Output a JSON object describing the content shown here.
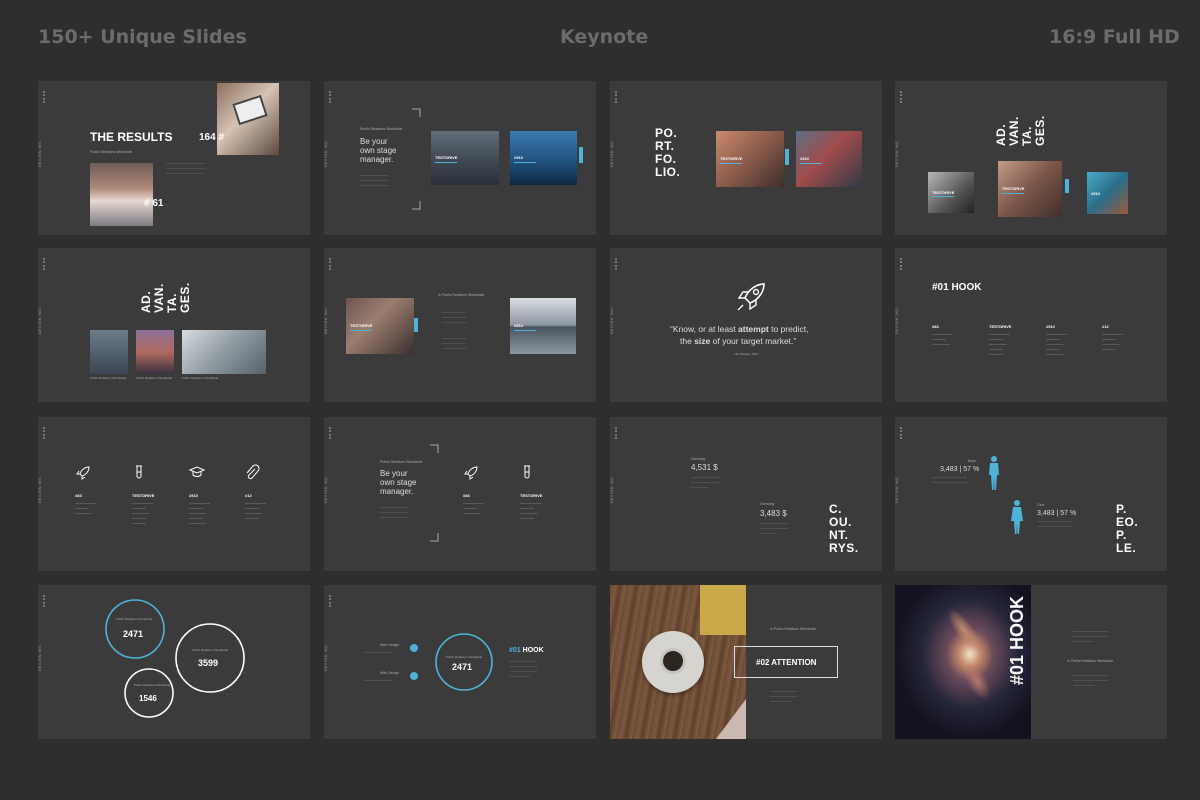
{
  "header": {
    "left": "150+ Unique Slides",
    "center": "Keynote",
    "right": "16:9 Full HD"
  },
  "common": {
    "brand": "DESIGN INC.",
    "testdrive": "TESTDRIVE",
    "num_510": "#510",
    "prw": "Public Relations Worldwide",
    "stage": [
      "Be your",
      "own stage",
      "manager."
    ],
    "cols": [
      "#83",
      "TESTDRIVE",
      "#510",
      "#12"
    ]
  },
  "slides": {
    "s1": {
      "title": "THE RESULTS",
      "num1": "164 #",
      "num2": "# 61"
    },
    "s3": {
      "lines": [
        "PO.",
        "RT.",
        "FO.",
        "LIO."
      ]
    },
    "s4": {
      "lines": [
        "AD.",
        "VAN.",
        "TA.",
        "GES."
      ]
    },
    "s7": {
      "quote_a": "“Know, or at least ",
      "quote_b": "attempt",
      "quote_c": " to predict,",
      "quote_d": "the ",
      "quote_e": "size",
      "quote_f": " of your target market.”",
      "author": "The Weaver, 1967"
    },
    "s8": {
      "title": "#01 HOOK"
    },
    "s11": {
      "label1": "Germany",
      "val1": "4,531 $",
      "label2": "Germany",
      "val2": "3,483 $",
      "lines": [
        "C.",
        "OU.",
        "NT.",
        "RYS."
      ]
    },
    "s12": {
      "label1": "Boys",
      "val1": "3,483 | 57 %",
      "label2": "Girls",
      "val2": "3,483 | 57 %",
      "lines": [
        "P.",
        "EO.",
        "P.",
        "LE."
      ]
    },
    "s13": {
      "c1": "2471",
      "c2": "3599",
      "c3": "1546"
    },
    "s14": {
      "web1": "Web Design",
      "web2": "Web Design",
      "circle": "2471",
      "title_num": "#01",
      "title_word": "HOOK"
    },
    "s15": {
      "title": "#02 ATTENTION"
    },
    "s16": {
      "vertical": "#01 HOOK"
    }
  }
}
